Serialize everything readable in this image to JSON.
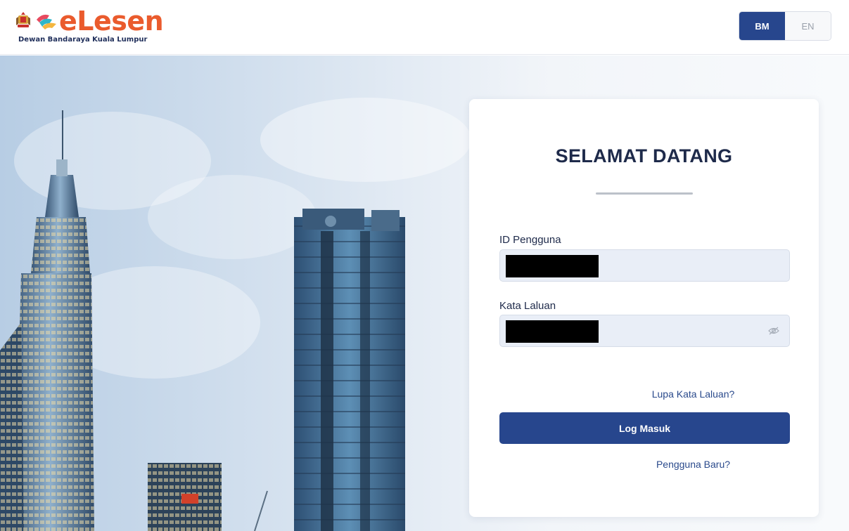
{
  "header": {
    "logo_text": "eLesen",
    "logo_subtitle": "Dewan Bandaraya Kuala Lumpur",
    "lang_bm": "BM",
    "lang_en": "EN",
    "active_lang": "BM"
  },
  "login": {
    "title": "SELAMAT DATANG",
    "user_label": "ID Pengguna",
    "user_value": "",
    "pass_label": "Kata Laluan",
    "pass_value": "",
    "forgot_link": "Lupa Kata Laluan?",
    "submit_label": "Log Masuk",
    "new_user_link": "Pengguna Baru?"
  },
  "colors": {
    "primary": "#27468d",
    "logo_orange": "#ea5b2d",
    "title_dark": "#1e2a4a"
  },
  "icons": {
    "password_toggle": "eye-icon"
  }
}
